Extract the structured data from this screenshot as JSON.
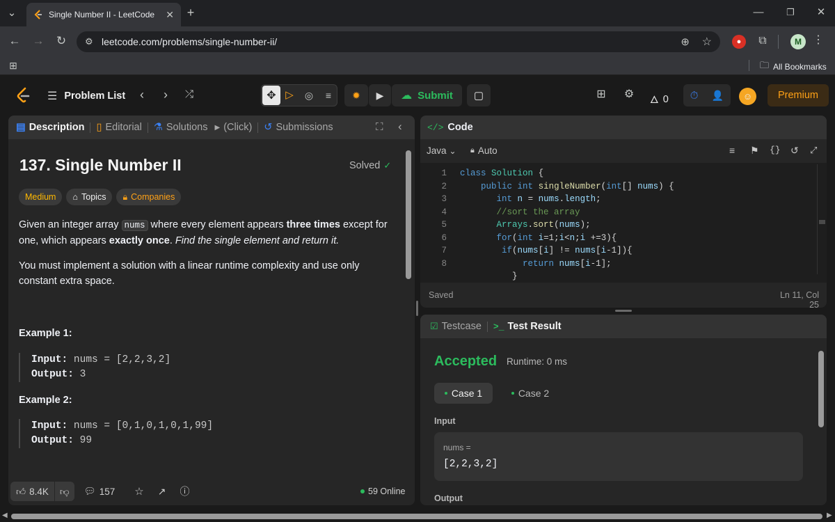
{
  "browser": {
    "tab_title": "Single Number II - LeetCode",
    "url": "leetcode.com/problems/single-number-ii/",
    "bookmarks_label": "All Bookmarks",
    "profile_initial": "M"
  },
  "nav": {
    "problem_list": "Problem List",
    "submit": "Submit",
    "streak_count": "0",
    "premium": "Premium"
  },
  "left": {
    "tabs": {
      "description": "Description",
      "editorial": "Editorial",
      "solutions": "Solutions",
      "click_hint": "(Click)",
      "submissions": "Submissions"
    },
    "title": "137. Single Number II",
    "solved": "Solved",
    "pills": {
      "difficulty": "Medium",
      "topics": "Topics",
      "companies": "Companies"
    },
    "desc1_a": "Given an integer array ",
    "desc1_code": "nums",
    "desc1_b": " where every element appears ",
    "desc1_bold1": "three times",
    "desc1_c": " except for one, which appears ",
    "desc1_bold2": "exactly once",
    "desc1_d": ". ",
    "desc1_italic": "Find the single element and return it.",
    "desc2": "You must implement a solution with a linear runtime complexity and use only constant extra space.",
    "examples": [
      {
        "heading": "Example 1:",
        "input_label": "Input:",
        "input": "nums = [2,2,3,2]",
        "output_label": "Output:",
        "output": "3"
      },
      {
        "heading": "Example 2:",
        "input_label": "Input:",
        "input": "nums = [0,1,0,1,0,1,99]",
        "output_label": "Output:",
        "output": "99"
      }
    ],
    "footer": {
      "likes": "8.4K",
      "comments": "157",
      "online": "59 Online"
    }
  },
  "code": {
    "title": "Code",
    "language": "Java",
    "mode": "Auto",
    "status": "Saved",
    "cursor": "Ln 11, Col 25",
    "line_numbers": [
      "1",
      "2",
      "3",
      "4",
      "5",
      "6",
      "7",
      "8"
    ]
  },
  "result": {
    "tab_testcase": "Testcase",
    "tab_result": "Test Result",
    "verdict": "Accepted",
    "runtime": "Runtime: 0 ms",
    "case1": "Case 1",
    "case2": "Case 2",
    "input_label": "Input",
    "var_label": "nums =",
    "var_value": "[2,2,3,2]",
    "output_label": "Output"
  },
  "colors": {
    "accent": "#ffa116",
    "accepted": "#2cbb5d",
    "medium": "#ffb800",
    "link": "#3b82f6"
  }
}
